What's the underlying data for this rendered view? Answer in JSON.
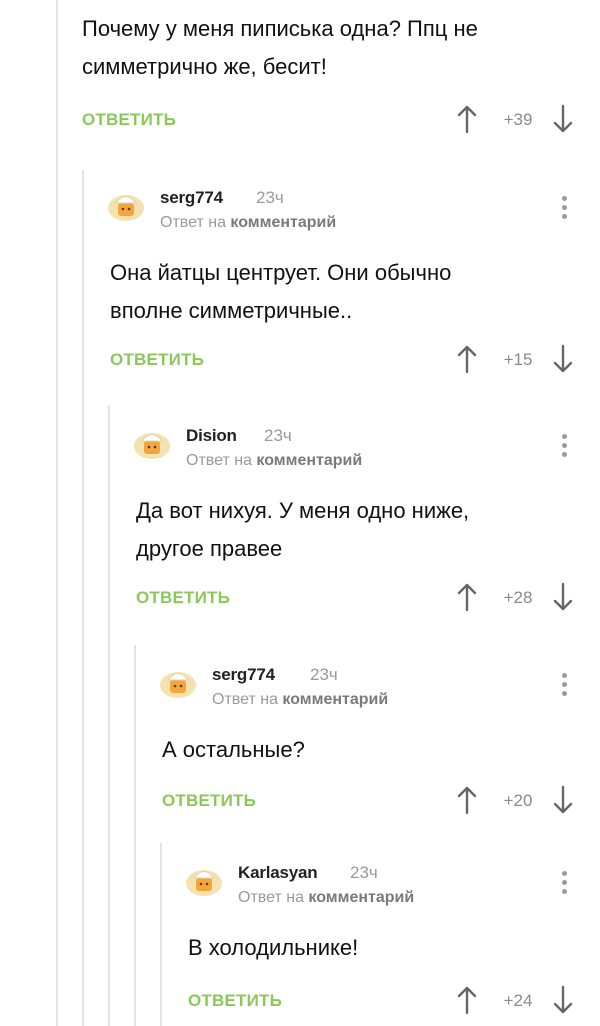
{
  "reply_label": "ОТВЕТИТЬ",
  "reply_to_prefix": "Ответ на",
  "reply_to_target": "комментарий",
  "accent_color": "#8ac858",
  "comments": [
    {
      "text": "Почему у меня пиписька одна? Ппц не\nсимметрично же, бесит!",
      "score": "+39"
    },
    {
      "username": "serg774",
      "time": "23ч",
      "text": "Она йатцы центрует. Они обычно\nвполне симметричные..",
      "score": "+15"
    },
    {
      "username": "Dision",
      "time": "23ч",
      "text": "Да вот нихуя. У меня одно ниже,\nдругое правее",
      "score": "+28"
    },
    {
      "username": "serg774",
      "time": "23ч",
      "text": "А остальные?",
      "score": "+20"
    },
    {
      "username": "Karlasyan",
      "time": "23ч",
      "text": "В холодильнике!",
      "score": "+24"
    }
  ],
  "icons": {
    "avatar": "default-avatar-icon",
    "upvote": "arrow-up-icon",
    "downvote": "arrow-down-icon",
    "more": "more-vertical-icon"
  }
}
